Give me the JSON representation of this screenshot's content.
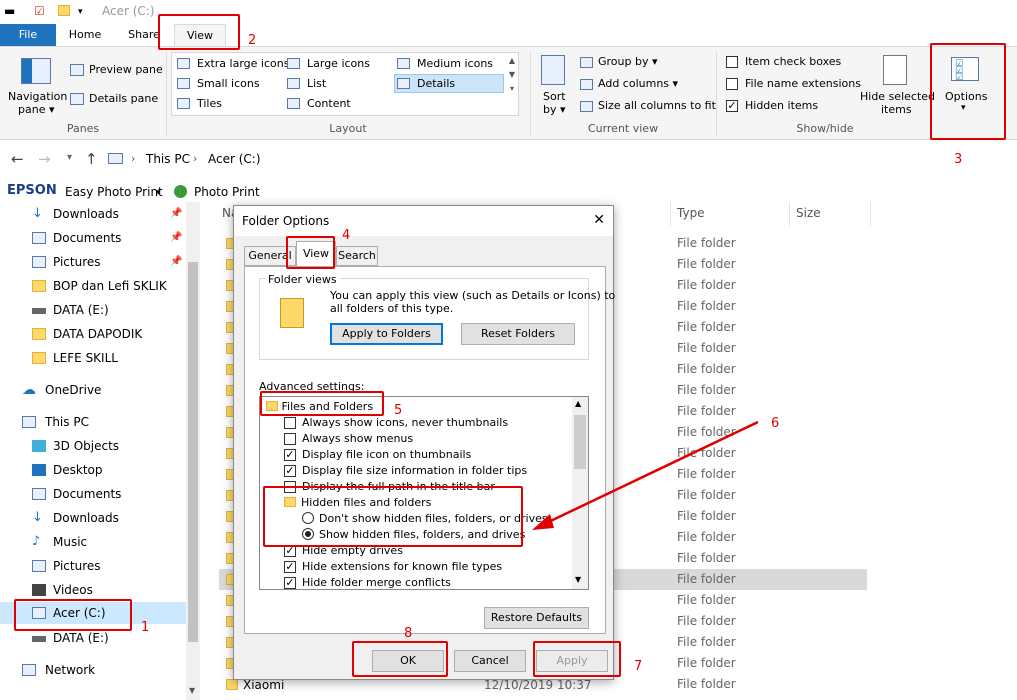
{
  "window": {
    "title": "Acer (C:)"
  },
  "tabs": {
    "file": "File",
    "home": "Home",
    "share": "Share",
    "view": "View"
  },
  "ribbon": {
    "panes": {
      "nav_label": "Navigation",
      "nav_label2": "pane ▾",
      "preview": "Preview pane",
      "details": "Details pane",
      "group": "Panes"
    },
    "layout": {
      "items": [
        "Extra large icons",
        "Large icons",
        "Medium icons",
        "Small icons",
        "List",
        "Details",
        "Tiles",
        "Content"
      ],
      "group": "Layout"
    },
    "current_view": {
      "sort": "Sort",
      "sort2": "by ▾",
      "group_by": "Group by ▾",
      "add_columns": "Add columns ▾",
      "size_all": "Size all columns to fit",
      "group": "Current view"
    },
    "show_hide": {
      "item_check": "Item check boxes",
      "file_ext": "File name extensions",
      "hidden_items": "Hidden items",
      "hide_selected": "Hide selected",
      "hide_selected2": "items",
      "group": "Show/hide"
    },
    "options": {
      "label": "Options",
      "arrow": "▾"
    }
  },
  "address": {
    "this_pc": "This PC",
    "drive": "Acer (C:)"
  },
  "epson": {
    "brand": "EPSON",
    "easy": "Easy Photo Print",
    "photo": "Photo Print"
  },
  "sidebar": {
    "quick": [
      "Downloads",
      "Documents",
      "Pictures",
      "BOP dan Lefi SKLIK",
      "DATA (E:)",
      "DATA DAPODIK",
      "LEFE SKILL"
    ],
    "onedrive": "OneDrive",
    "thispc": "This PC",
    "pc_items": [
      "3D Objects",
      "Desktop",
      "Documents",
      "Downloads",
      "Music",
      "Pictures",
      "Videos",
      "Acer (C:)",
      "DATA (E:)"
    ],
    "network": "Network"
  },
  "list": {
    "col_name": "Na",
    "col_type": "Type",
    "col_size": "Size",
    "type_value": "File folder",
    "last_name": "Xiaomi",
    "last_date": "12/10/2019 10:37"
  },
  "dialog": {
    "title": "Folder Options",
    "close": "✕",
    "tabs": [
      "General",
      "View",
      "Search"
    ],
    "folder_views": {
      "legend": "Folder views",
      "desc1": "You can apply this view (such as Details or Icons) to",
      "desc2": "all folders of this type.",
      "apply": "Apply to Folders",
      "reset": "Reset Folders"
    },
    "advanced_label": "Advanced settings:",
    "tree": {
      "root": "Files and Folders",
      "items": [
        "Always show icons, never thumbnails",
        "Always show menus",
        "Display file icon on thumbnails",
        "Display file size information in folder tips",
        "Display the full path in the title bar"
      ],
      "hidden_group": "Hidden files and folders",
      "radio_dont": "Don't show hidden files, folders, or drives",
      "radio_show": "Show hidden files, folders, and drives",
      "after": [
        "Hide empty drives",
        "Hide extensions for known file types",
        "Hide folder merge conflicts"
      ]
    },
    "restore": "Restore Defaults",
    "ok": "OK",
    "cancel": "Cancel",
    "apply": "Apply"
  },
  "annotations": [
    "1",
    "2",
    "3",
    "4",
    "5",
    "6",
    "7",
    "8"
  ],
  "colors": {
    "accent": "#1e73be",
    "annotation": "#e00000",
    "selection": "#cce4f7"
  }
}
